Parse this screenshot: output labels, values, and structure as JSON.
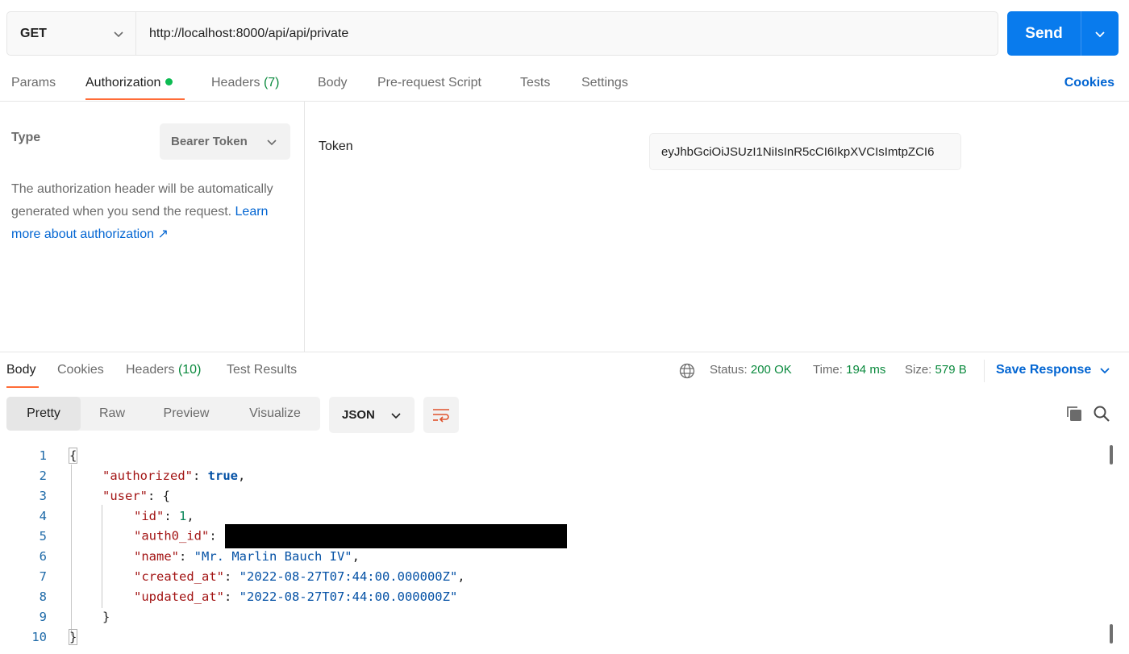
{
  "request": {
    "method": "GET",
    "url": "http://localhost:8000/api/api/private",
    "send_label": "Send"
  },
  "request_tabs": [
    {
      "label": "Params",
      "count": ""
    },
    {
      "label": "Authorization",
      "count": ""
    },
    {
      "label": "Headers",
      "count": "(7)"
    },
    {
      "label": "Body",
      "count": ""
    },
    {
      "label": "Pre-request Script",
      "count": ""
    },
    {
      "label": "Tests",
      "count": ""
    },
    {
      "label": "Settings",
      "count": ""
    }
  ],
  "cookies_label": "Cookies",
  "auth": {
    "type_label": "Type",
    "type_value": "Bearer Token",
    "description": "The authorization header will be automatically generated when you send the request. ",
    "learn_more": "Learn more about authorization ↗",
    "token_label": "Token",
    "token_value": "eyJhbGciOiJSUzI1NiIsInR5cCI6IkpXVCIsImtpZCI6"
  },
  "response_tabs": [
    {
      "label": "Body",
      "count": ""
    },
    {
      "label": "Cookies",
      "count": ""
    },
    {
      "label": "Headers",
      "count": "(10)"
    },
    {
      "label": "Test Results",
      "count": ""
    }
  ],
  "response_meta": {
    "status_label": "Status:",
    "status_value": "200 OK",
    "time_label": "Time:",
    "time_value": "194 ms",
    "size_label": "Size:",
    "size_value": "579 B",
    "save_label": "Save Response"
  },
  "view_options": [
    "Pretty",
    "Raw",
    "Preview",
    "Visualize"
  ],
  "format": "JSON",
  "code_lines": [
    "1",
    "2",
    "3",
    "4",
    "5",
    "6",
    "7",
    "8",
    "9",
    "10"
  ],
  "json": {
    "k_authorized": "\"authorized\"",
    "v_authorized": "true",
    "k_user": "\"user\"",
    "k_id": "\"id\"",
    "v_id": "1",
    "k_auth0": "\"auth0_id\"",
    "k_name": "\"name\"",
    "v_name": "\"Mr. Marlin Bauch IV\"",
    "k_created": "\"created_at\"",
    "v_created": "\"2022-08-27T07:44:00.000000Z\"",
    "k_updated": "\"updated_at\"",
    "v_updated": "\"2022-08-27T07:44:00.000000Z\""
  },
  "colors": {
    "accent": "#097bed",
    "tab_underline": "#ff6c37",
    "success": "#0b8a3e",
    "link": "#0265d2"
  }
}
